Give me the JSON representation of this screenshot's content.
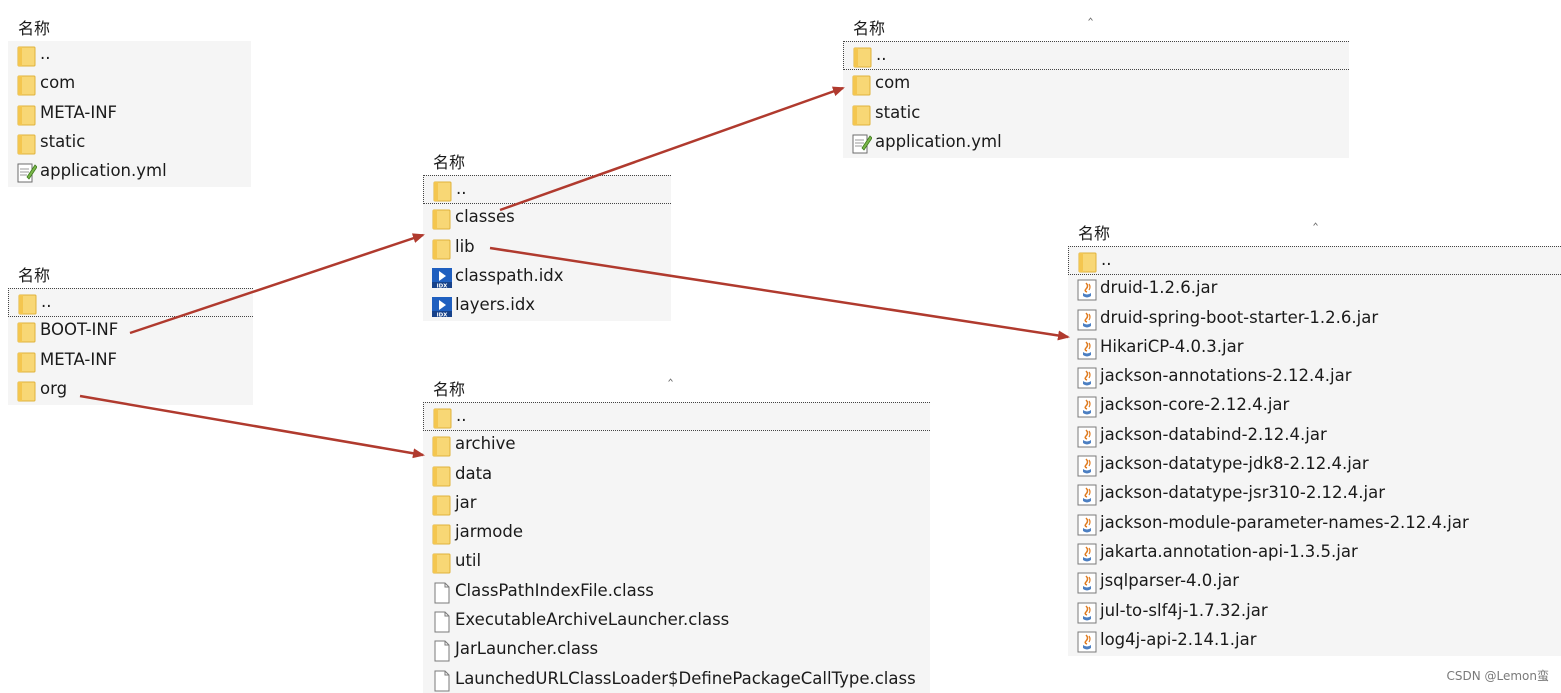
{
  "column_header": "名称",
  "panels": {
    "boot_classes": {
      "items": [
        {
          "label": "..",
          "icon": "folder-icon"
        },
        {
          "label": "com",
          "icon": "folder-icon"
        },
        {
          "label": "META-INF",
          "icon": "folder-icon"
        },
        {
          "label": "static",
          "icon": "folder-icon"
        },
        {
          "label": "application.yml",
          "icon": "yml-file-icon"
        }
      ]
    },
    "jar_root": {
      "items": [
        {
          "label": "..",
          "icon": "folder-icon"
        },
        {
          "label": "BOOT-INF",
          "icon": "folder-icon"
        },
        {
          "label": "META-INF",
          "icon": "folder-icon"
        },
        {
          "label": "org",
          "icon": "folder-icon"
        }
      ]
    },
    "boot_inf": {
      "items": [
        {
          "label": "..",
          "icon": "folder-icon"
        },
        {
          "label": "classes",
          "icon": "folder-icon"
        },
        {
          "label": "lib",
          "icon": "folder-icon"
        },
        {
          "label": "classpath.idx",
          "icon": "idx-file-icon"
        },
        {
          "label": "layers.idx",
          "icon": "idx-file-icon"
        }
      ]
    },
    "org_loader": {
      "items": [
        {
          "label": "..",
          "icon": "folder-icon"
        },
        {
          "label": "archive",
          "icon": "folder-icon"
        },
        {
          "label": "data",
          "icon": "folder-icon"
        },
        {
          "label": "jar",
          "icon": "folder-icon"
        },
        {
          "label": "jarmode",
          "icon": "folder-icon"
        },
        {
          "label": "util",
          "icon": "folder-icon"
        },
        {
          "label": "ClassPathIndexFile.class",
          "icon": "class-file-icon"
        },
        {
          "label": "ExecutableArchiveLauncher.class",
          "icon": "class-file-icon"
        },
        {
          "label": "JarLauncher.class",
          "icon": "class-file-icon"
        },
        {
          "label": "LaunchedURLClassLoader$DefinePackageCallType.class",
          "icon": "class-file-icon"
        }
      ]
    },
    "classes_dir": {
      "items": [
        {
          "label": "..",
          "icon": "folder-icon"
        },
        {
          "label": "com",
          "icon": "folder-icon"
        },
        {
          "label": "static",
          "icon": "folder-icon"
        },
        {
          "label": "application.yml",
          "icon": "yml-file-icon"
        }
      ]
    },
    "lib_dir": {
      "items": [
        {
          "label": "..",
          "icon": "folder-icon"
        },
        {
          "label": "druid-1.2.6.jar",
          "icon": "jar-file-icon"
        },
        {
          "label": "druid-spring-boot-starter-1.2.6.jar",
          "icon": "jar-file-icon"
        },
        {
          "label": "HikariCP-4.0.3.jar",
          "icon": "jar-file-icon"
        },
        {
          "label": "jackson-annotations-2.12.4.jar",
          "icon": "jar-file-icon"
        },
        {
          "label": "jackson-core-2.12.4.jar",
          "icon": "jar-file-icon"
        },
        {
          "label": "jackson-databind-2.12.4.jar",
          "icon": "jar-file-icon"
        },
        {
          "label": "jackson-datatype-jdk8-2.12.4.jar",
          "icon": "jar-file-icon"
        },
        {
          "label": "jackson-datatype-jsr310-2.12.4.jar",
          "icon": "jar-file-icon"
        },
        {
          "label": "jackson-module-parameter-names-2.12.4.jar",
          "icon": "jar-file-icon"
        },
        {
          "label": "jakarta.annotation-api-1.3.5.jar",
          "icon": "jar-file-icon"
        },
        {
          "label": "jsqlparser-4.0.jar",
          "icon": "jar-file-icon"
        },
        {
          "label": "jul-to-slf4j-1.7.32.jar",
          "icon": "jar-file-icon"
        },
        {
          "label": "log4j-api-2.14.1.jar",
          "icon": "jar-file-icon"
        }
      ]
    }
  },
  "colors": {
    "arrow": "#b03a2e",
    "folder": "#f8d775",
    "folder_edge": "#e0b23c",
    "row_background": "#f5f5f5"
  },
  "watermark": "CSDN @Lemon蛮"
}
